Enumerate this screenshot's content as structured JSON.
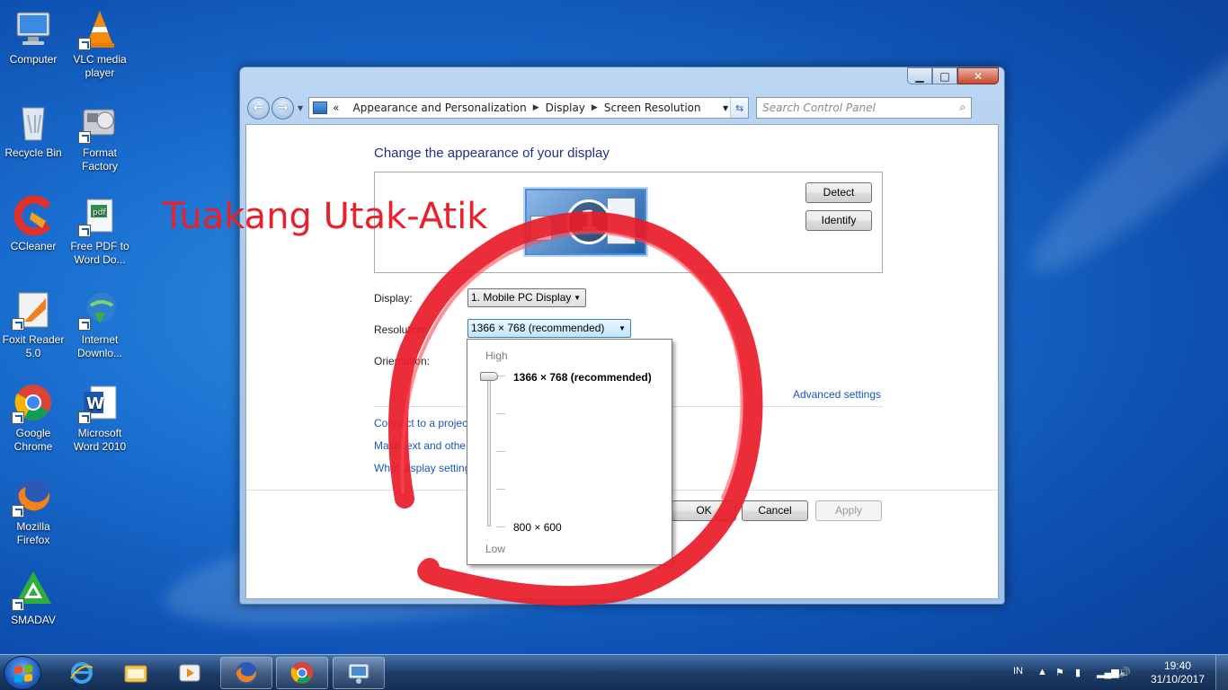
{
  "desktop": {
    "icons": [
      {
        "label": "Computer"
      },
      {
        "label": "VLC media player"
      },
      {
        "label": "Recycle Bin"
      },
      {
        "label": "Format Factory"
      },
      {
        "label": "CCleaner"
      },
      {
        "label": "Free PDF to Word Do..."
      },
      {
        "label": "Foxit Reader 5.0"
      },
      {
        "label": "Internet Downlo..."
      },
      {
        "label": "Google Chrome"
      },
      {
        "label": "Microsoft Word 2010"
      },
      {
        "label": "Mozilla Firefox"
      },
      {
        "label": "SMADAV"
      }
    ],
    "watermark": "Tuakang Utak-Atik"
  },
  "window": {
    "breadcrumb": {
      "prefix": "«",
      "items": [
        "Appearance and Personalization",
        "Display",
        "Screen Resolution"
      ]
    },
    "search_placeholder": "Search Control Panel",
    "heading": "Change the appearance of your display",
    "monitor_number": "1",
    "buttons": {
      "detect": "Detect",
      "identify": "Identify",
      "ok": "OK",
      "cancel": "Cancel",
      "apply": "Apply"
    },
    "display": {
      "label": "Display:",
      "value": "1. Mobile PC Display"
    },
    "resolution": {
      "label": "Resolution:",
      "value": "1366 × 768 (recommended)"
    },
    "orientation": {
      "label": "Orientation:"
    },
    "links": {
      "advanced": "Advanced settings",
      "projector": "Connect to a projector",
      "text_size": "Make text and other items larger or smaller",
      "which_settings": "What display settings should I choose?"
    },
    "resolution_dropdown": {
      "high_label": "High",
      "low_label": "Low",
      "current": "1366 × 768 (recommended)",
      "minimum": "800 × 600",
      "slider_level": 1.0
    }
  },
  "taskbar": {
    "pinned": [
      {
        "icon": "internet-explorer-icon"
      },
      {
        "icon": "windows-explorer-icon"
      },
      {
        "icon": "media-player-icon"
      },
      {
        "icon": "firefox-icon"
      },
      {
        "icon": "chrome-icon"
      },
      {
        "icon": "control-panel-icon"
      }
    ],
    "language": "IN",
    "time": "19:40",
    "date": "31/10/2017"
  },
  "colors": {
    "watermark": "#e8212b",
    "link": "#1a56b8",
    "heading": "#1e3287",
    "red_mark": "#e81d2a"
  }
}
